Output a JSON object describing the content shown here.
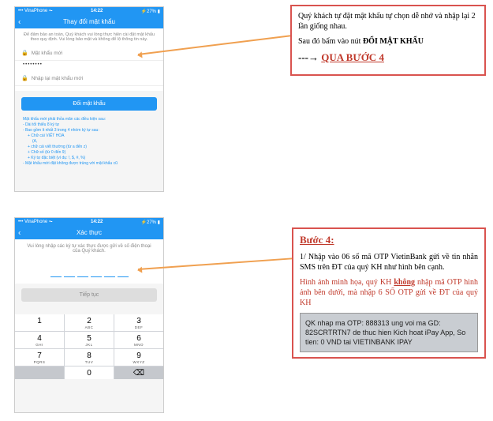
{
  "phone1": {
    "status": {
      "carrier": "••• VinaPhone ⏦",
      "time": "14:22",
      "battery": "⚡27% ▮"
    },
    "header": "Thay đổi mật khẩu",
    "info": "Để đảm bảo an toàn, Quý khách vui lòng thực hiện cài đặt mật khẩu theo quy định. Vui lòng bảo mật và không để lộ thông tin này.",
    "field1_label": "Mật khẩu mới",
    "field1_value": "••••••••",
    "field2_label": "Nhập lại mật khẩu mới",
    "button": "Đổi mật khẩu",
    "rules": {
      "title": "Mật khẩu mới phải thỏa mãn các điều kiện sau:",
      "r1": "- Dài tối thiểu 8 ký tự",
      "r2": "- Bao gồm ít nhất 3 trong 4 nhóm ký tự sau:",
      "r2a": "+ Chữ cái VIẾT HOA",
      "r2a_sub": "(A,",
      "r2b": "+ chữ cái viết thường (từ a đến z)",
      "r2c": "+ Chữ số (từ 0 đến 9)",
      "r2d": "+ Ký tự đặc biệt (ví dụ: !, $, #, %)",
      "r3": "- Mật khẩu mới đặt không được trùng với mật khẩu cũ"
    }
  },
  "phone2": {
    "status": {
      "carrier": "••• VinaPhone ⏦",
      "time": "14:22",
      "battery": "⚡27% ▮"
    },
    "header": "Xác thực",
    "info": "Vui lòng nhập các ký tự xác thực được gửi về số điện thoại của Quý khách.",
    "button": "Tiếp tục",
    "keypad": [
      {
        "n": "1",
        "l": ""
      },
      {
        "n": "2",
        "l": "ABC"
      },
      {
        "n": "3",
        "l": "DEF"
      },
      {
        "n": "4",
        "l": "GHI"
      },
      {
        "n": "5",
        "l": "JKL"
      },
      {
        "n": "6",
        "l": "MNO"
      },
      {
        "n": "7",
        "l": "PQRS"
      },
      {
        "n": "8",
        "l": "TUV"
      },
      {
        "n": "9",
        "l": "WXYZ"
      },
      {
        "n": "",
        "l": ""
      },
      {
        "n": "0",
        "l": ""
      },
      {
        "n": "⌫",
        "l": ""
      }
    ]
  },
  "callout1": {
    "p1": "Quý khách tự đặt mật khẩu tự chọn dễ nhớ và nhập lại 2 lần giống nhau.",
    "p2a": "Sau đó bấm vào nút ",
    "p2b": "ĐỔI MẬT KHẨU",
    "arrow": "---→ ",
    "link": "QUA BƯỚC 4"
  },
  "callout2": {
    "title": "Bước 4:",
    "p1": "1/ Nhập vào 06 số mã OTP VietinBank gửi về tin nhắn SMS trên ĐT của quý KH như hình bên cạnh.",
    "p2a": "Hình ảnh minh họa, quý KH ",
    "p2b": "không",
    "p2c": " nhập mã OTP hình ảnh bên dưới, mà nhập 6 SỐ OTP gửi về ĐT của quý KH",
    "sms": "QK nhap ma OTP: 888313 ung voi ma GD: 82SCRTRTN7 de thuc hien Kich hoat iPay App, So tien: 0 VND tai VIETINBANK IPAY"
  }
}
